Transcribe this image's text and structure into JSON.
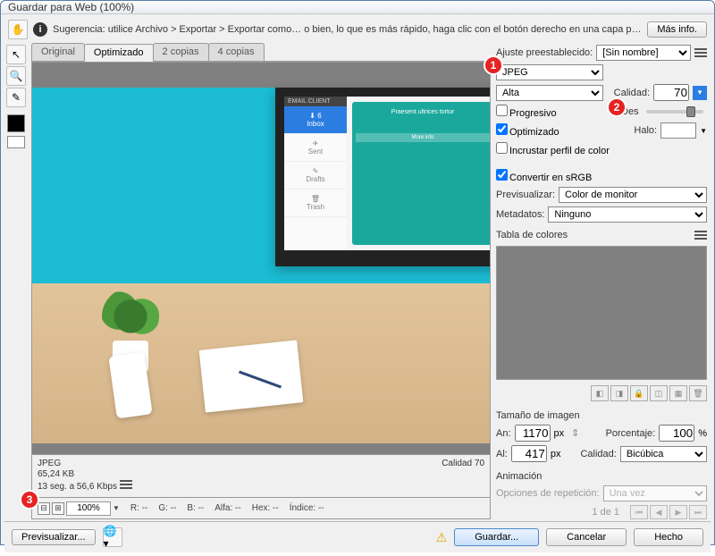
{
  "window": {
    "title": "Guardar para Web (100%)"
  },
  "hint": {
    "text": "Sugerencia: utilice Archivo > Exportar > Exportar como… o bien, lo que es más rápido, haga clic con el botón derecho en una capa para exportar los recursos",
    "more_info": "Más info."
  },
  "tabs": {
    "original": "Original",
    "optimizado": "Optimizado",
    "dos": "2 copias",
    "cuatro": "4 copias"
  },
  "preview": {
    "format": "JPEG",
    "size": "65,24 KB",
    "time": "13 seg. a 56,6 Kbps",
    "quality_label": "Calidad 70",
    "mockup": {
      "header": "EMAIL CLIENT",
      "inbox": "Inbox",
      "inbox_count": "6",
      "sent": "Sent",
      "drafts": "Drafts",
      "trash": "Trash",
      "card_title": "Praesent ultrices tortor",
      "card_btn": "More info"
    }
  },
  "status": {
    "zoom": "100%",
    "r": "R: --",
    "g": "G: --",
    "b": "B: --",
    "alfa": "Alfa: --",
    "hex": "Hex: --",
    "indice": "Índice: --"
  },
  "right": {
    "preset_label": "Ajuste preestablecido:",
    "preset_value": "[Sin nombre]",
    "format": "JPEG",
    "quality_preset": "Alta",
    "quality_label": "Calidad:",
    "quality_value": "70",
    "progresivo": "Progresivo",
    "desenf": "Des",
    "optimizado": "Optimizado",
    "halo": "Halo:",
    "incrustar": "Incrustar perfil de color",
    "convertir": "Convertir en sRGB",
    "previs_label": "Previsualizar:",
    "previs_value": "Color de monitor",
    "meta_label": "Metadatos:",
    "meta_value": "Ninguno",
    "tabla": "Tabla de colores",
    "tamano": "Tamaño de imagen",
    "an": "An:",
    "an_v": "1170",
    "al": "Al:",
    "al_v": "417",
    "px": "px",
    "pct_label": "Porcentaje:",
    "pct_v": "100",
    "pct_sym": "%",
    "calidad2": "Calidad:",
    "calidad2_v": "Bicúbica",
    "anim": "Animación",
    "rep_label": "Opciones de repetición:",
    "rep_v": "Una vez",
    "page": "1 de 1"
  },
  "bottom": {
    "previs": "Previsualizar...",
    "guardar": "Guardar...",
    "cancelar": "Cancelar",
    "hecho": "Hecho"
  },
  "badges": {
    "b1": "1",
    "b2": "2",
    "b3": "3"
  }
}
